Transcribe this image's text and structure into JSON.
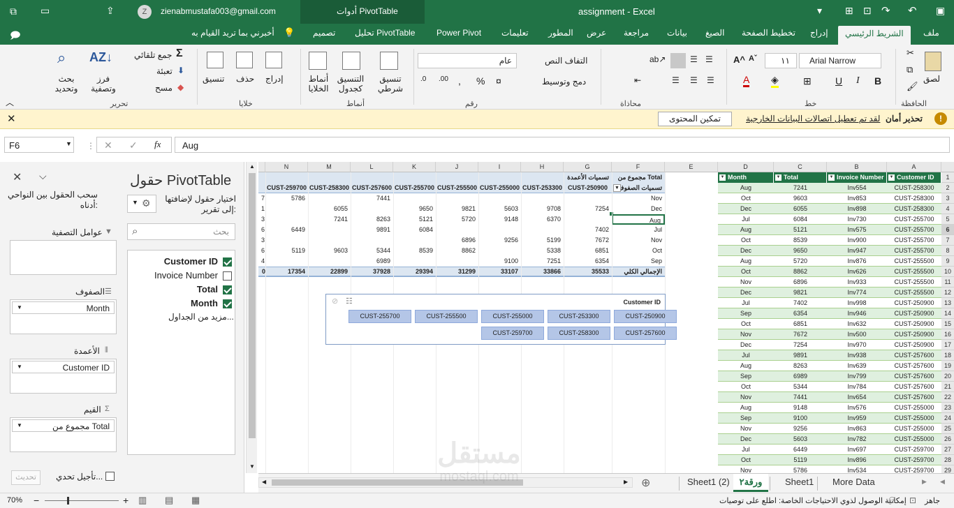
{
  "window": {
    "title": "assignment  -  Excel",
    "account": "zienabmustafa003@gmail.com",
    "avatar": "Z",
    "context_tab": "أدوات PivotTable"
  },
  "tabs": {
    "file": "ملف",
    "home": "الشريط الرئيسي",
    "insert": "إدراج",
    "layout": "تخطيط الصفحة",
    "formulas": "الصيغ",
    "data": "بيانات",
    "review": "مراجعة",
    "view": "عرض",
    "developer": "المطور",
    "help": "تعليمات",
    "powerpivot": "Power Pivot",
    "analyze": "تحليل PivotTable",
    "design": "تصميم",
    "tellme": "أخبرني بما تريد القيام به"
  },
  "ribbon": {
    "paste": "لصق",
    "clipboard": "الحافظة",
    "font_name": "Arial Narrow",
    "font_size": "١١",
    "font_group": "خط",
    "wrap": "التفاف النص",
    "merge": "دمج وتوسيط",
    "align_group": "محاذاة",
    "num_format": "عام",
    "num_group": "رقم",
    "cond_format": "تنسيق شرطي",
    "format_table": "التنسيق كجدول",
    "cell_styles": "أنماط الخلايا",
    "styles_group": "أنماط",
    "insert_cells": "إدراج",
    "delete_cells": "حذف",
    "format_cells": "تنسيق",
    "cells_group": "خلايا",
    "autosum": "جمع تلقائي",
    "fill": "تعبئة",
    "clear": "مسح",
    "sort": "فرز وتصفية",
    "find": "بحث وتحديد",
    "edit_group": "تحرير"
  },
  "message": {
    "title": "تحذير أمان",
    "text": "لقد تم تعطيل اتصالات البيانات الخارجية",
    "button": "تمكين المحتوى"
  },
  "formula": {
    "namebox": "F6",
    "value": "Aug"
  },
  "pane": {
    "title": "حقول PivotTable",
    "choose": "اختيار حقول لإضافتها إلى تقرير:",
    "search": "بحث",
    "fields": [
      "Customer ID",
      "Invoice Number",
      "Total",
      "Month"
    ],
    "fields_checked": [
      true,
      false,
      true,
      true
    ],
    "more": "مزيد من الجداول...",
    "drag": "سحب الحقول بين النواحي أدناه:",
    "filters": "عوامل التصفية",
    "rows": "الصفوف",
    "rows_item": "Month",
    "columns": "الأعمدة",
    "columns_item": "Customer ID",
    "values": "القيم",
    "values_item": "مجموع من Total",
    "defer": "تأجيل تحدي...",
    "update": "تحديث"
  },
  "columns": [
    "A",
    "B",
    "C",
    "D",
    "E",
    "F",
    "G",
    "H",
    "I",
    "J",
    "K",
    "L",
    "M",
    "N"
  ],
  "source": {
    "headers": [
      "Customer ID",
      "Invoice Number",
      "Total",
      "Month"
    ],
    "rows": [
      [
        "CUST-258300",
        "Inv554",
        "7241",
        "Aug"
      ],
      [
        "CUST-258300",
        "Inv853",
        "9603",
        "Oct"
      ],
      [
        "CUST-258300",
        "Inv898",
        "6055",
        "Dec"
      ],
      [
        "CUST-255700",
        "Inv730",
        "6084",
        "Jul"
      ],
      [
        "CUST-255700",
        "Inv575",
        "5121",
        "Aug"
      ],
      [
        "CUST-255700",
        "Inv900",
        "8539",
        "Oct"
      ],
      [
        "CUST-255700",
        "Inv947",
        "9650",
        "Dec"
      ],
      [
        "CUST-255500",
        "Inv876",
        "5720",
        "Aug"
      ],
      [
        "CUST-255500",
        "Inv626",
        "8862",
        "Oct"
      ],
      [
        "CUST-255500",
        "Inv933",
        "6896",
        "Nov"
      ],
      [
        "CUST-255500",
        "Inv774",
        "9821",
        "Dec"
      ],
      [
        "CUST-250900",
        "Inv998",
        "7402",
        "Jul"
      ],
      [
        "CUST-250900",
        "Inv946",
        "6354",
        "Sep"
      ],
      [
        "CUST-250900",
        "Inv632",
        "6851",
        "Oct"
      ],
      [
        "CUST-250900",
        "Inv500",
        "7672",
        "Nov"
      ],
      [
        "CUST-250900",
        "Inv970",
        "7254",
        "Dec"
      ],
      [
        "CUST-257600",
        "Inv938",
        "9891",
        "Jul"
      ],
      [
        "CUST-257600",
        "Inv639",
        "8263",
        "Aug"
      ],
      [
        "CUST-257600",
        "Inv799",
        "6989",
        "Sep"
      ],
      [
        "CUST-257600",
        "Inv784",
        "5344",
        "Oct"
      ],
      [
        "CUST-257600",
        "Inv654",
        "7441",
        "Nov"
      ],
      [
        "CUST-255000",
        "Inv576",
        "9148",
        "Aug"
      ],
      [
        "CUST-255000",
        "Inv959",
        "9100",
        "Sep"
      ],
      [
        "CUST-255000",
        "Inv863",
        "9256",
        "Nov"
      ],
      [
        "CUST-255000",
        "Inv782",
        "5603",
        "Dec"
      ],
      [
        "CUST-259700",
        "Inv697",
        "6449",
        "Jul"
      ],
      [
        "CUST-259700",
        "Inv896",
        "5119",
        "Oct"
      ],
      [
        "CUST-259700",
        "Inv534",
        "5786",
        "Nov"
      ]
    ],
    "row_numbers": [
      "1",
      "2",
      "3",
      "4",
      "5",
      "6",
      "7",
      "8",
      "9",
      "10",
      "11",
      "12",
      "13",
      "14",
      "15",
      "16",
      "17",
      "18",
      "19",
      "20",
      "21",
      "22",
      "23",
      "24",
      "25",
      "26",
      "27",
      "28",
      "29"
    ]
  },
  "pivot": {
    "sum_label": "مجموع من Total",
    "col_labels": "تسميات الأعمدة",
    "row_labels": "تسميات الصفوف",
    "total_label": "الإجمالي الكلي",
    "cust_cols": [
      "CUST-250900",
      "CUST-253300",
      "CUST-255000",
      "CUST-255500",
      "CUST-255700",
      "CUST-257600",
      "CUST-258300",
      "CUST-259700"
    ],
    "months": [
      "Nov",
      "Dec",
      "Aug",
      "Jul",
      "Nov",
      "Oct",
      "Sep"
    ],
    "grid": [
      [
        "",
        "",
        "",
        "",
        "",
        "7441",
        "",
        "5786"
      ],
      [
        "7254",
        "9708",
        "5603",
        "9821",
        "9650",
        "",
        "6055",
        ""
      ],
      [
        "",
        "6370",
        "9148",
        "5720",
        "5121",
        "8263",
        "7241",
        ""
      ],
      [
        "7402",
        "",
        "",
        "",
        "6084",
        "9891",
        "",
        "6449"
      ],
      [
        "7672",
        "5199",
        "9256",
        "6896",
        "",
        "",
        "",
        ""
      ],
      [
        "6851",
        "5338",
        "",
        "8862",
        "8539",
        "5344",
        "9603",
        "5119"
      ],
      [
        "6354",
        "7251",
        "9100",
        "",
        "",
        "6989",
        "",
        ""
      ]
    ],
    "edge": [
      "7",
      "1",
      "3",
      "6",
      "3",
      "6",
      "4"
    ],
    "totals": [
      "35533",
      "33866",
      "33107",
      "31299",
      "29394",
      "37928",
      "22899",
      "17354"
    ],
    "edge_total": "0"
  },
  "slicer": {
    "title": "Customer ID",
    "items": [
      "CUST-250900",
      "CUST-253300",
      "CUST-255000",
      "CUST-255500",
      "CUST-255700",
      "CUST-257600",
      "CUST-258300",
      "CUST-259700"
    ]
  },
  "sheets": {
    "more": "More Data",
    "s1": "Sheet1",
    "active": "ورقة٢",
    "s2": "Sheet1 (2)"
  },
  "status": {
    "ready": "جاهز",
    "access": "إمكانية الوصول لذوي الاحتياجات الخاصة: اطلع على توصيات",
    "zoom": "70%"
  },
  "watermark": {
    "main": "مستقل",
    "sub": "mostaql.com"
  },
  "colors": {
    "accent": "#217346",
    "pivot_header": "#dce6f1",
    "slicer_item": "#b4c6e7"
  }
}
